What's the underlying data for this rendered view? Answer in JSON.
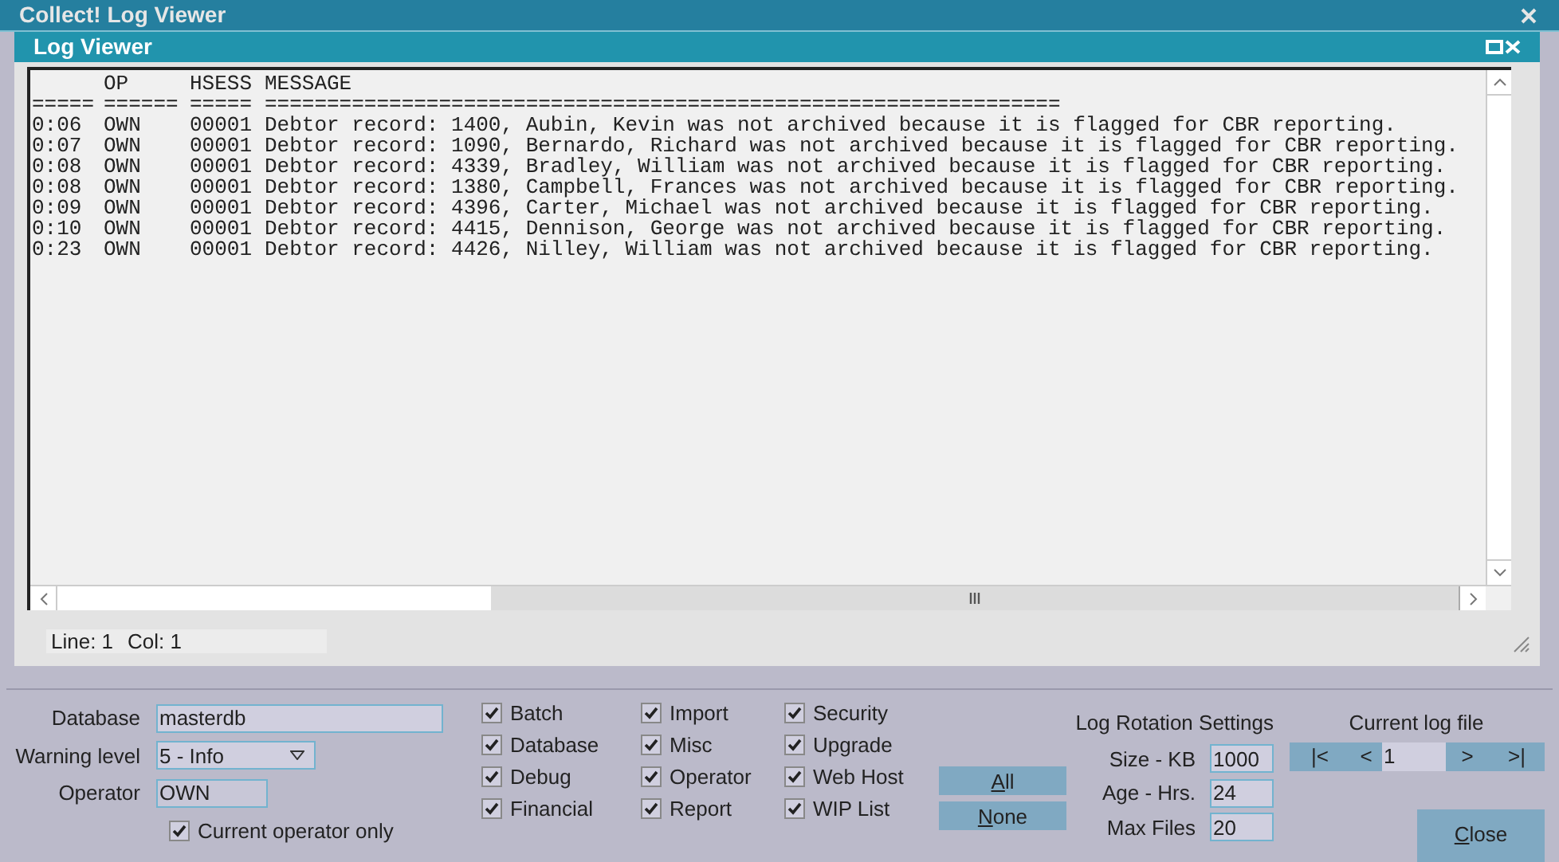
{
  "window": {
    "title": "Collect! Log Viewer"
  },
  "panel": {
    "title": "Log Viewer"
  },
  "log": {
    "header": {
      "op": "OP",
      "hsess": "HSESS",
      "message": "MESSAGE"
    },
    "separator": {
      "time": "=====",
      "op": "======",
      "hsess": "=====",
      "message": "================================================================"
    },
    "rows": [
      {
        "time": "0:06",
        "op": "OWN",
        "hsess": "00001",
        "message": "Debtor record: 1400, Aubin, Kevin was not archived because it is flagged for CBR reporting."
      },
      {
        "time": "0:07",
        "op": "OWN",
        "hsess": "00001",
        "message": "Debtor record: 1090, Bernardo, Richard was not archived because it is flagged for CBR reporting."
      },
      {
        "time": "0:08",
        "op": "OWN",
        "hsess": "00001",
        "message": "Debtor record: 4339, Bradley, William was not archived because it is flagged for CBR reporting."
      },
      {
        "time": "0:08",
        "op": "OWN",
        "hsess": "00001",
        "message": "Debtor record: 1380, Campbell, Frances was not archived because it is flagged for CBR reporting."
      },
      {
        "time": "0:09",
        "op": "OWN",
        "hsess": "00001",
        "message": "Debtor record: 4396, Carter, Michael was not archived because it is flagged for CBR reporting."
      },
      {
        "time": "0:10",
        "op": "OWN",
        "hsess": "00001",
        "message": "Debtor record: 4415, Dennison, George was not archived because it is flagged for CBR reporting."
      },
      {
        "time": "0:23",
        "op": "OWN",
        "hsess": "00001",
        "message": "Debtor record: 4426, Nilley, William was not archived because it is flagged for CBR reporting."
      }
    ]
  },
  "status": {
    "line": "Line: 1",
    "col": "Col: 1"
  },
  "filters": {
    "database": {
      "label": "Database",
      "value": "masterdb"
    },
    "warning_level": {
      "label": "Warning level",
      "value": "5 - Info"
    },
    "operator": {
      "label": "Operator",
      "value": "OWN"
    },
    "current_operator_only": {
      "label": "Current operator only",
      "checked": true
    }
  },
  "categories": [
    [
      {
        "label": "Batch",
        "checked": true
      },
      {
        "label": "Database",
        "checked": true
      },
      {
        "label": "Debug",
        "checked": true
      },
      {
        "label": "Financial",
        "checked": true
      }
    ],
    [
      {
        "label": "Import",
        "checked": true
      },
      {
        "label": "Misc",
        "checked": true
      },
      {
        "label": "Operator",
        "checked": true
      },
      {
        "label": "Report",
        "checked": true
      }
    ],
    [
      {
        "label": "Security",
        "checked": true
      },
      {
        "label": "Upgrade",
        "checked": true
      },
      {
        "label": "Web Host",
        "checked": true
      },
      {
        "label": "WIP List",
        "checked": true
      }
    ]
  ],
  "select_buttons": [
    "All",
    "None"
  ],
  "log_rotation": {
    "title": "Log Rotation Settings",
    "fields": [
      {
        "label": "Size - KB",
        "value": "1000"
      },
      {
        "label": "Age - Hrs.",
        "value": "24"
      },
      {
        "label": "Max Files",
        "value": "20"
      }
    ]
  },
  "current_log_file": {
    "title": "Current log file",
    "first": "|<",
    "prev": "<",
    "value": "1",
    "next": ">",
    "last": ">|"
  },
  "close_button": "Close"
}
